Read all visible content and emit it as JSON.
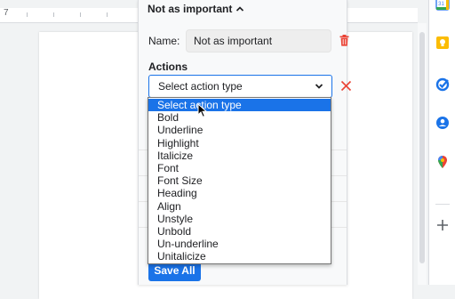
{
  "ruler": {
    "mark": "7"
  },
  "panel": {
    "header_title": "Not as important",
    "name_label": "Name:",
    "name_value": "Not as important",
    "actions_label": "Actions",
    "action_select": {
      "value": "Select action type",
      "options": [
        "Select action type",
        "Bold",
        "Underline",
        "Highlight",
        "Italicize",
        "Font",
        "Font Size",
        "Heading",
        "Align",
        "Unstyle",
        "Unbold",
        "Un-underline",
        "Unitalicize"
      ]
    },
    "save_label": "Save All"
  },
  "side_panel": {
    "icons": [
      "calendar-icon",
      "keep-icon",
      "tasks-icon",
      "contacts-icon",
      "maps-icon",
      "add-icon"
    ],
    "calendar_day": "31"
  },
  "colors": {
    "accent": "#1a73e8",
    "danger": "#ea4335",
    "panel_bg": "#f8f9fa"
  }
}
